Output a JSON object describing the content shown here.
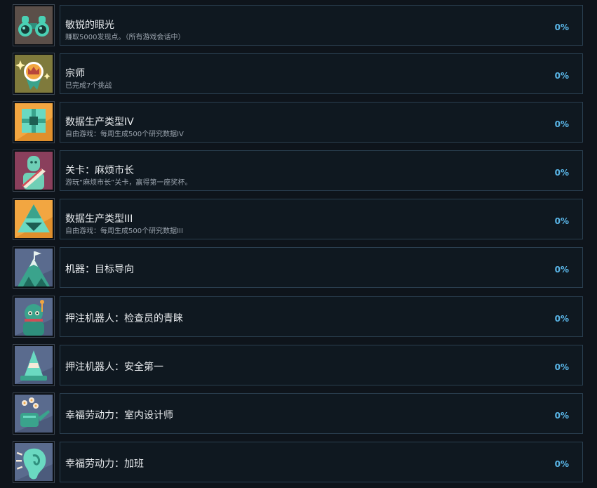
{
  "achievements": [
    {
      "title": "敏锐的眼光",
      "desc": "赚取5000发现点。（所有游戏会话中）",
      "percent": "0%",
      "icon": "binoculars-icon"
    },
    {
      "title": "宗师",
      "desc": "已完成7个挑战",
      "percent": "0%",
      "icon": "crown-medal-icon"
    },
    {
      "title": "数据生产类型IV",
      "desc": "自由游戏：每周生成500个研究数据IV",
      "percent": "0%",
      "icon": "data-cube-icon"
    },
    {
      "title": "关卡：麻烦市长",
      "desc": "游玩“麻烦市长”关卡，赢得第一座奖杯。",
      "percent": "0%",
      "icon": "mayor-sash-icon"
    },
    {
      "title": "数据生产类型III",
      "desc": "自由游戏：每周生成500个研究数据III",
      "percent": "0%",
      "icon": "data-pyramid-icon"
    },
    {
      "title": "机器：目标导向",
      "desc": "",
      "percent": "0%",
      "icon": "mountain-flag-icon"
    },
    {
      "title": "押注机器人：检查员的青睐",
      "desc": "",
      "percent": "0%",
      "icon": "inspector-robot-icon"
    },
    {
      "title": "押注机器人：安全第一",
      "desc": "",
      "percent": "0%",
      "icon": "traffic-cone-icon"
    },
    {
      "title": "幸福劳动力：室内设计师",
      "desc": "",
      "percent": "0%",
      "icon": "watering-can-icon"
    },
    {
      "title": "幸福劳动力：加班",
      "desc": "",
      "percent": "0%",
      "icon": "ear-icon"
    }
  ]
}
